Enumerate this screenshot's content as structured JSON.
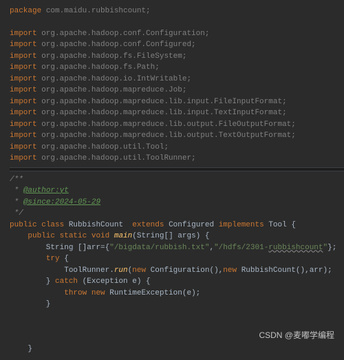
{
  "package_kw": "package",
  "import_kw": "import",
  "package_line": " com.maidu.rubbishcount;",
  "imports": [
    " org.apache.hadoop.conf.Configuration;",
    " org.apache.hadoop.conf.Configured;",
    " org.apache.hadoop.fs.FileSystem;",
    " org.apache.hadoop.fs.Path;",
    " org.apache.hadoop.io.IntWritable;",
    " org.apache.hadoop.mapreduce.Job;",
    " org.apache.hadoop.mapreduce.lib.input.FileInputFormat;",
    " org.apache.hadoop.mapreduce.lib.input.TextInputFormat;",
    " org.apache.hadoop.mapreduce.lib.output.FileOutputFormat;",
    " org.apache.hadoop.mapreduce.lib.output.TextOutputFormat;",
    " org.apache.hadoop.util.Tool;",
    " org.apache.hadoop.util.ToolRunner;"
  ],
  "doc": {
    "open": "/**",
    "star": " * ",
    "author_tag": "@author:",
    "author_val": "yt",
    "since_tag": "@since:",
    "since_val": "2024-05-29",
    "close": " */"
  },
  "code": {
    "public": "public",
    "class": "class",
    "classname": " RubbishCount  ",
    "extends": "extends",
    "configured": " Configured ",
    "implements": "implements",
    "tool": " Tool {",
    "static": "static",
    "void": "void",
    "main": " main",
    "main_params": "(String[] args) {",
    "arr_decl": "        String []arr={",
    "str1": "\"/bigdata/rubbish.txt\"",
    "comma": ",",
    "str2_a": "\"/hdfs/2301-",
    "str2_b": "rubbishcount",
    "str2_c": "\"",
    "arr_end": "};",
    "try": "try",
    "try_open": " {",
    "toolrunner": "            ToolRunner.",
    "run": "run",
    "run_open": "(",
    "new": "new",
    "conf": " Configuration(),",
    "rcount": " RubbishCount(),arr);",
    "catch": "catch",
    "catch_param": " (Exception e) {",
    "throw": "throw",
    "rte": " RuntimeException(e);",
    "brace_close": "        }",
    "brace_close2": "        }",
    "method_close": "    }"
  },
  "watermark": "CSDN @麦嘟学编程"
}
